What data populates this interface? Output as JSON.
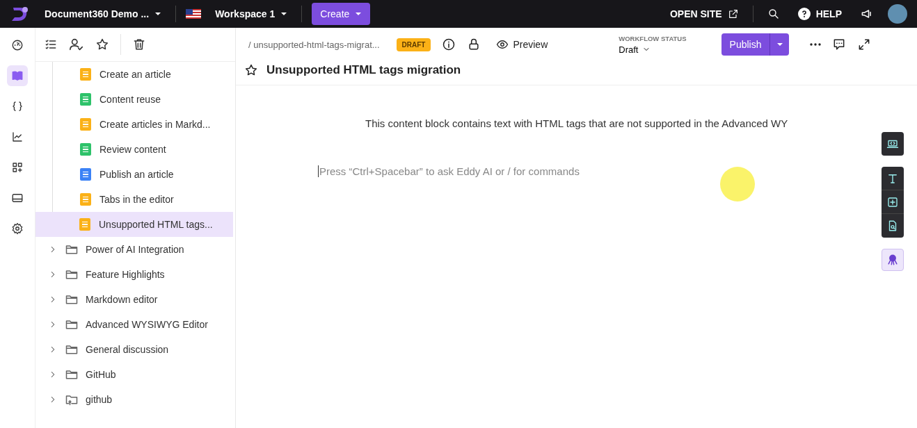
{
  "topbar": {
    "project": "Document360 Demo ...",
    "workspace": "Workspace 1",
    "create": "Create",
    "open_site": "OPEN SITE",
    "help": "HELP"
  },
  "rail": [
    {
      "kind": "dashboard",
      "selected": false
    },
    {
      "kind": "docs",
      "selected": true
    },
    {
      "kind": "api",
      "selected": false
    },
    {
      "kind": "analytics",
      "selected": false
    },
    {
      "kind": "apps",
      "selected": false
    },
    {
      "kind": "widget",
      "selected": false
    },
    {
      "kind": "settings",
      "selected": false
    }
  ],
  "tree": {
    "articles": [
      {
        "label": "Create an article",
        "color": "#fbb117",
        "selected": false
      },
      {
        "label": "Content reuse",
        "color": "#2ec26a",
        "selected": false
      },
      {
        "label": "Create articles in Markd...",
        "color": "#fbb117",
        "selected": false
      },
      {
        "label": "Review content",
        "color": "#2ec26a",
        "selected": false
      },
      {
        "label": "Publish an article",
        "color": "#3b82f6",
        "selected": false
      },
      {
        "label": "Tabs in the editor",
        "color": "#fbb117",
        "selected": false
      },
      {
        "label": "Unsupported HTML tags...",
        "color": "#fbb117",
        "selected": true
      }
    ],
    "folders": [
      {
        "label": "Power of AI Integration",
        "kind": "folder",
        "expanded": false
      },
      {
        "label": "Feature Highlights",
        "kind": "folder",
        "expanded": false
      },
      {
        "label": "Markdown editor",
        "kind": "folder",
        "expanded": false
      },
      {
        "label": "Advanced WYSIWYG Editor",
        "kind": "folder",
        "expanded": false
      },
      {
        "label": "General discussion",
        "kind": "folder",
        "expanded": false
      },
      {
        "label": "GitHub",
        "kind": "folder",
        "expanded": false
      },
      {
        "label": "github",
        "kind": "repo",
        "expanded": false
      }
    ]
  },
  "editor": {
    "breadcrumb": "/ unsupported-html-tags-migrat...",
    "status_badge": "DRAFT",
    "preview": "Preview",
    "workflow_label": "WORKFLOW STATUS",
    "workflow_value": "Draft",
    "publish": "Publish",
    "title": "Unsupported HTML tags migration",
    "content": "This content block contains text with HTML tags that are not supported in the Advanced WY",
    "placeholder": "Press “Ctrl+Spacebar” to ask Eddy AI or / for commands"
  }
}
